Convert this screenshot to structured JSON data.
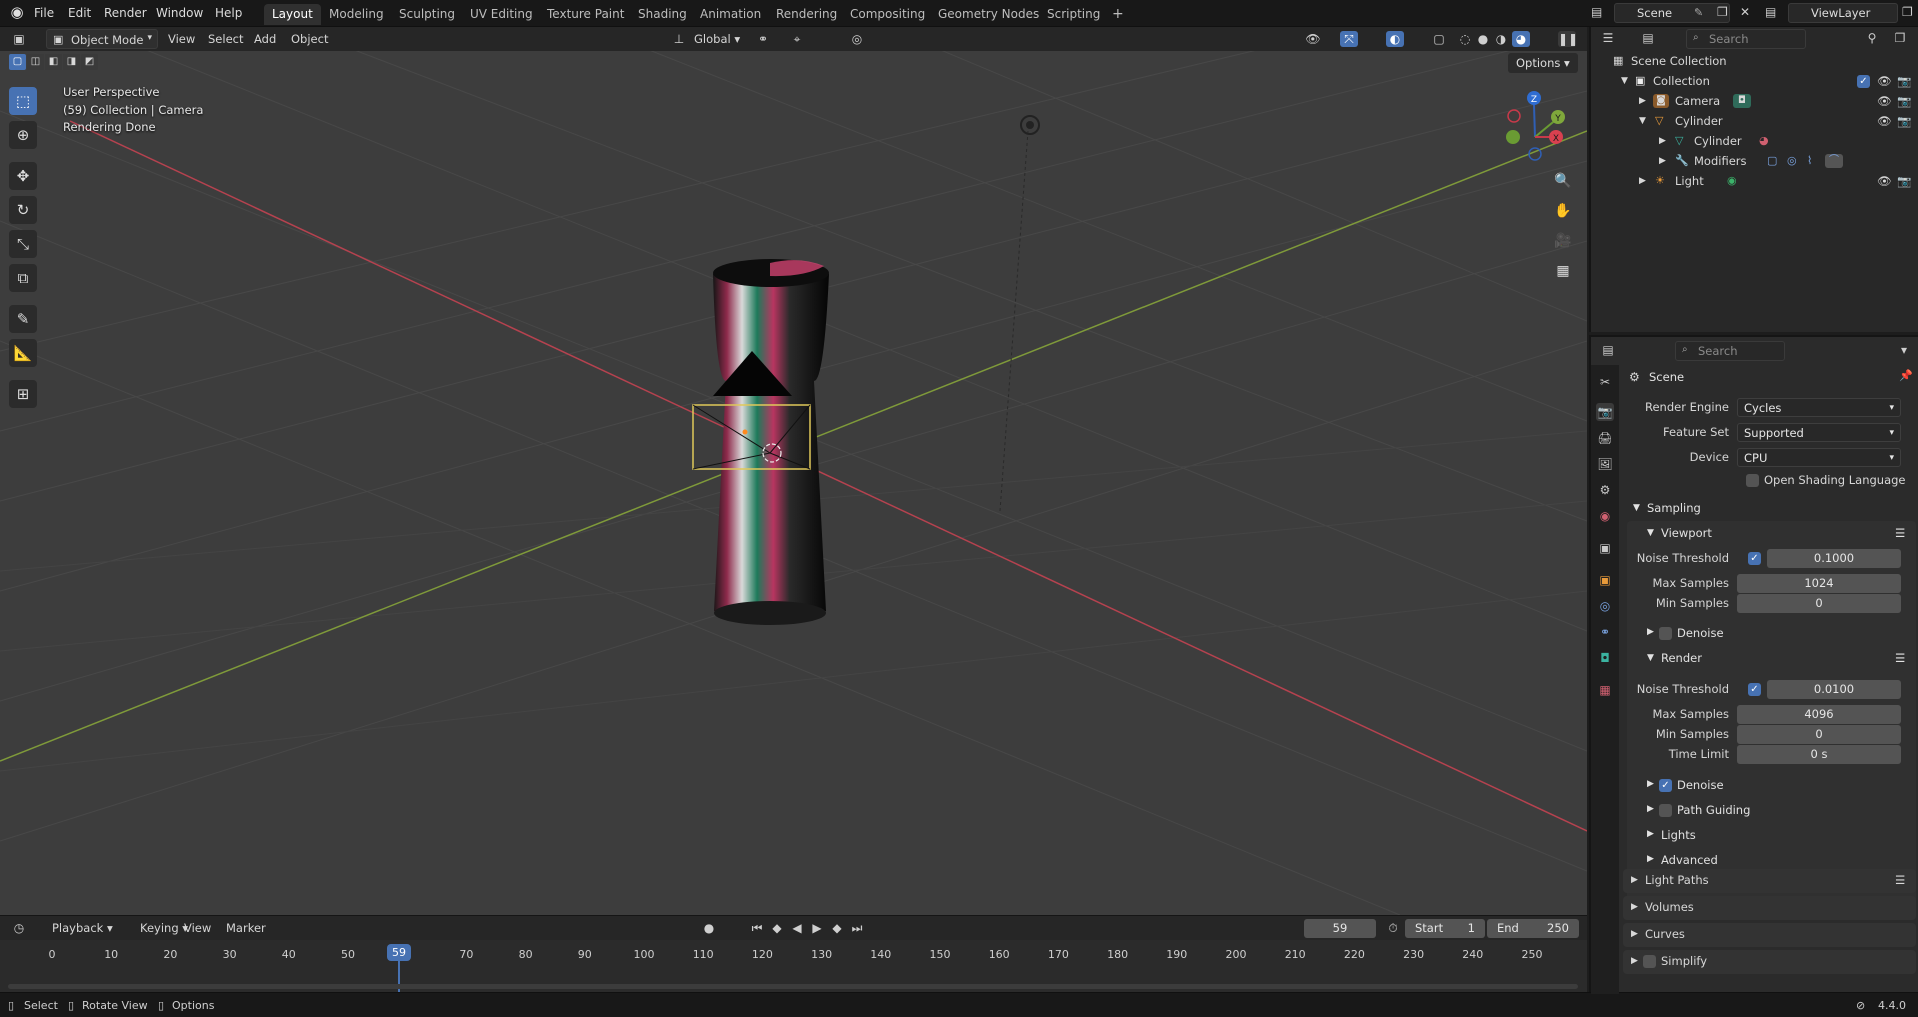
{
  "topbar": {
    "menus": [
      "File",
      "Edit",
      "Render",
      "Window",
      "Help"
    ],
    "workspaces": [
      "Layout",
      "Modeling",
      "Sculpting",
      "UV Editing",
      "Texture Paint",
      "Shading",
      "Animation",
      "Rendering",
      "Compositing",
      "Geometry Nodes",
      "Scripting"
    ],
    "active_workspace": "Layout",
    "scene": "Scene",
    "view_layer": "ViewLayer"
  },
  "viewport_header": {
    "mode": "Object Mode",
    "menus": [
      "View",
      "Select",
      "Add",
      "Object"
    ],
    "orientation": "Global",
    "options_label": "Options"
  },
  "viewport": {
    "overlay_lines": [
      "User Perspective",
      "(59) Collection | Camera",
      "Rendering Done"
    ],
    "gizmo_labels": {
      "x": "X",
      "y": "Y",
      "z": "Z"
    }
  },
  "timeline": {
    "menus": [
      "Playback",
      "Keying",
      "View",
      "Marker"
    ],
    "current_frame": "59",
    "start_label": "Start",
    "start": "1",
    "end_label": "End",
    "end": "250",
    "ticks": [
      "0",
      "10",
      "20",
      "30",
      "40",
      "50",
      "59",
      "70",
      "80",
      "90",
      "100",
      "110",
      "120",
      "130",
      "140",
      "150",
      "160",
      "170",
      "180",
      "190",
      "200",
      "210",
      "220",
      "230",
      "240",
      "250"
    ]
  },
  "statusbar": {
    "items": [
      "Select",
      "Rotate View",
      "Options"
    ],
    "version": "4.4.0"
  },
  "outliner": {
    "search_placeholder": "Search",
    "rows": [
      {
        "label": "Scene Collection"
      },
      {
        "label": "Collection"
      },
      {
        "label": "Camera"
      },
      {
        "label": "Cylinder"
      },
      {
        "label": "Cylinder"
      },
      {
        "label": "Modifiers"
      },
      {
        "label": "Light"
      }
    ]
  },
  "properties": {
    "search_placeholder": "Search",
    "context": "Scene",
    "render_engine_label": "Render Engine",
    "render_engine": "Cycles",
    "feature_set_label": "Feature Set",
    "feature_set": "Supported",
    "device_label": "Device",
    "device": "CPU",
    "osl_label": "Open Shading Language",
    "sampling": {
      "title": "Sampling",
      "viewport": {
        "title": "Viewport",
        "noise_threshold_label": "Noise Threshold",
        "noise_threshold": "0.1000",
        "max_samples_label": "Max Samples",
        "max_samples": "1024",
        "min_samples_label": "Min Samples",
        "min_samples": "0",
        "denoise_label": "Denoise"
      },
      "render": {
        "title": "Render",
        "noise_threshold_label": "Noise Threshold",
        "noise_threshold": "0.0100",
        "max_samples_label": "Max Samples",
        "max_samples": "4096",
        "min_samples_label": "Min Samples",
        "min_samples": "0",
        "time_limit_label": "Time Limit",
        "time_limit": "0 s",
        "denoise_label": "Denoise",
        "path_guiding_label": "Path Guiding",
        "lights_label": "Lights",
        "advanced_label": "Advanced"
      }
    },
    "panels": [
      "Light Paths",
      "Volumes",
      "Curves",
      "Simplify"
    ]
  }
}
